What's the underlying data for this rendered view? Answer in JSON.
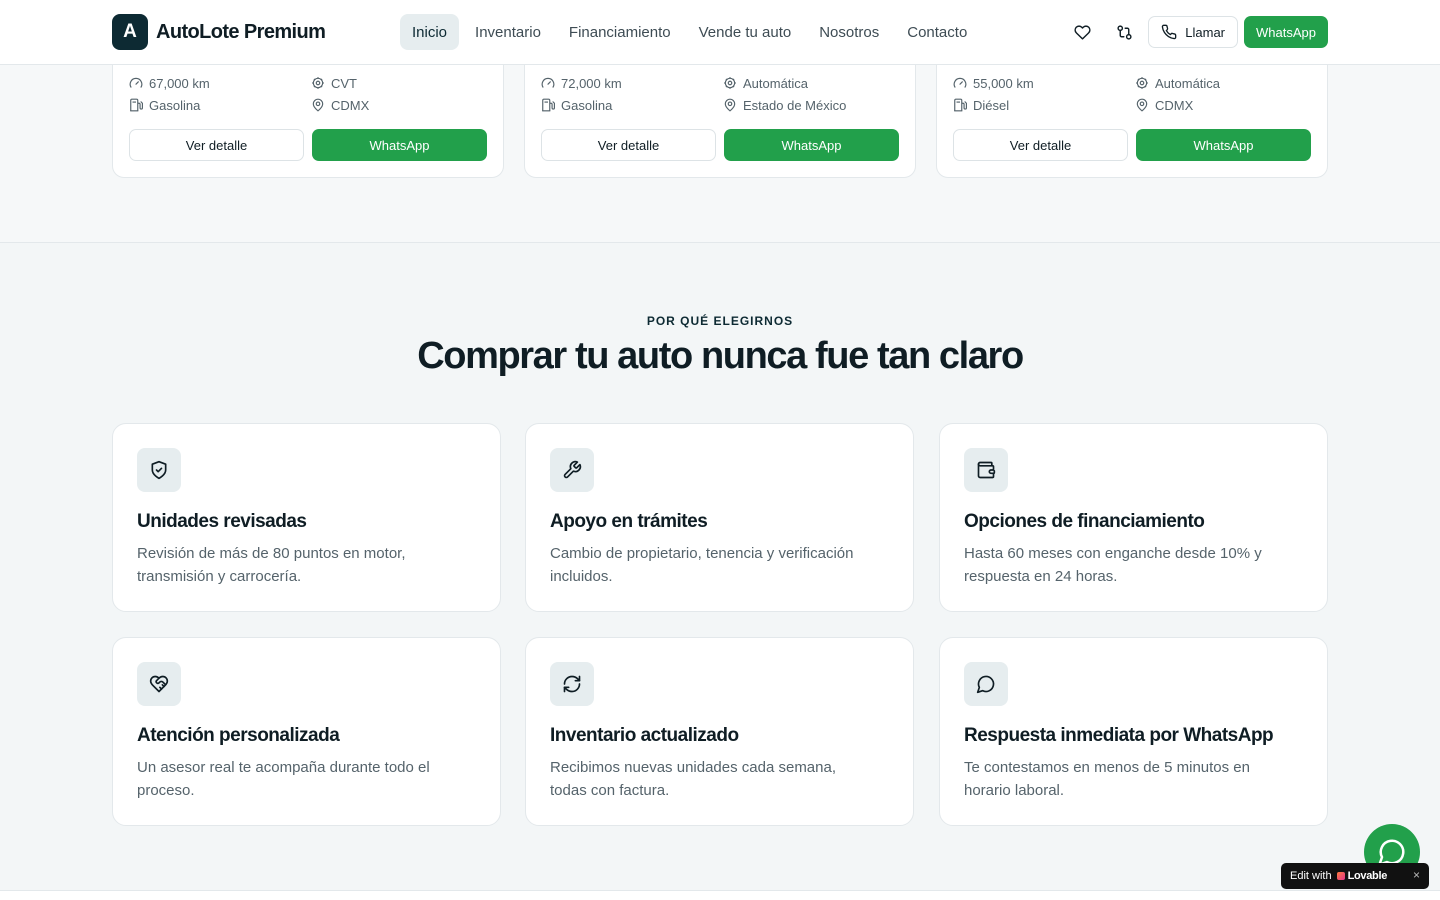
{
  "header": {
    "brand_mark": "A",
    "brand_name": "AutoLote Premium",
    "nav": [
      {
        "label": "Inicio",
        "active": true
      },
      {
        "label": "Inventario"
      },
      {
        "label": "Financiamiento"
      },
      {
        "label": "Vende tu auto"
      },
      {
        "label": "Nosotros"
      },
      {
        "label": "Contacto"
      }
    ],
    "call_label": "Llamar",
    "whatsapp_label": "WhatsApp"
  },
  "cars": [
    {
      "km": "67,000 km",
      "transmission": "CVT",
      "fuel": "Gasolina",
      "location": "CDMX",
      "detail_label": "Ver detalle",
      "whatsapp_label": "WhatsApp"
    },
    {
      "km": "72,000 km",
      "transmission": "Automática",
      "fuel": "Gasolina",
      "location": "Estado de México",
      "detail_label": "Ver detalle",
      "whatsapp_label": "WhatsApp"
    },
    {
      "km": "55,000 km",
      "transmission": "Automática",
      "fuel": "Diésel",
      "location": "CDMX",
      "detail_label": "Ver detalle",
      "whatsapp_label": "WhatsApp"
    }
  ],
  "why": {
    "eyebrow": "POR QUÉ ELEGIRNOS",
    "title": "Comprar tu auto nunca fue tan claro",
    "features": [
      {
        "icon": "shield-check-icon",
        "title": "Unidades revisadas",
        "desc": "Revisión de más de 80 puntos en motor, transmisión y carrocería."
      },
      {
        "icon": "wrench-icon",
        "title": "Apoyo en trámites",
        "desc": "Cambio de propietario, tenencia y verificación incluidos."
      },
      {
        "icon": "wallet-icon",
        "title": "Opciones de financiamiento",
        "desc": "Hasta 60 meses con enganche desde 10% y respuesta en 24 horas."
      },
      {
        "icon": "heart-handshake-icon",
        "title": "Atención personalizada",
        "desc": "Un asesor real te acompaña durante todo el proceso."
      },
      {
        "icon": "refresh-icon",
        "title": "Inventario actualizado",
        "desc": "Recibimos nuevas unidades cada semana, todas con factura."
      },
      {
        "icon": "message-circle-icon",
        "title": "Respuesta inmediata por WhatsApp",
        "desc": "Te contestamos en menos de 5 minutos en horario laboral."
      }
    ]
  },
  "lovable_badge": {
    "prefix": "Edit with",
    "brand": "Lovable",
    "close": "×"
  },
  "colors": {
    "primary": "#0d2a33",
    "whatsapp": "#22a04b",
    "muted": "#55636b"
  }
}
